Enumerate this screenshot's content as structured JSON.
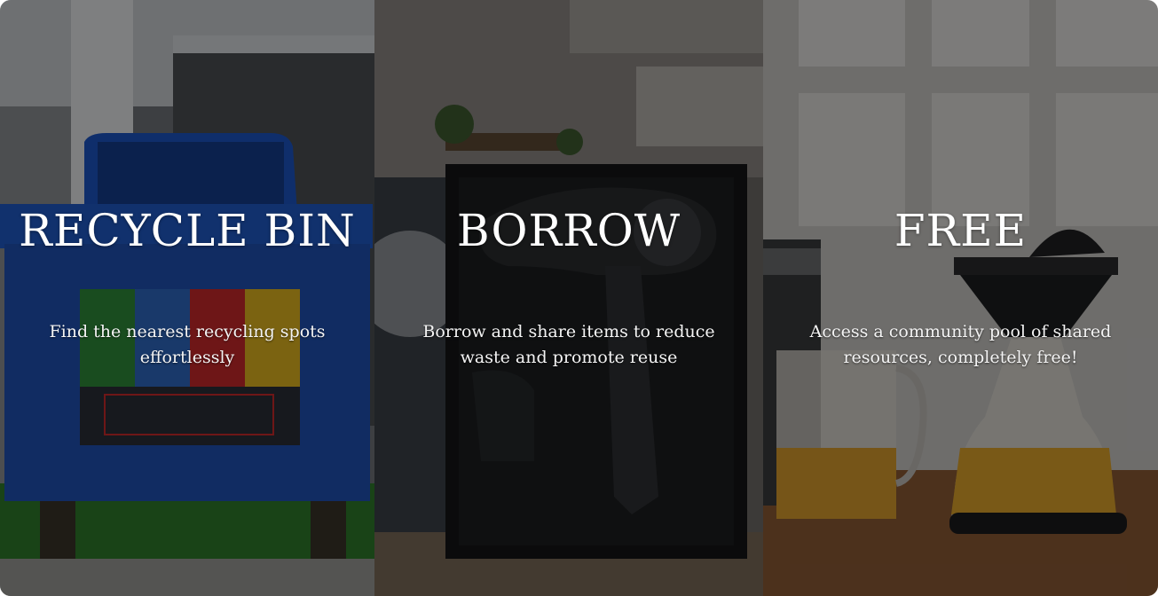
{
  "panels": [
    {
      "title": "RECYCLE BIN",
      "description": "Find the nearest recycling spots effortlessly",
      "image": "recycling-bin-photo"
    },
    {
      "title": "BORROW",
      "description": "Borrow and share items to reduce waste and promote reuse",
      "image": "hair-dryer-box-photo"
    },
    {
      "title": "FREE",
      "description": "Access a community pool of shared resources, completely free!",
      "image": "juicer-appliance-photo"
    }
  ],
  "colors": {
    "overlay": "#000000",
    "text": "#ffffff",
    "bin_blue": "#1f4fa8"
  }
}
